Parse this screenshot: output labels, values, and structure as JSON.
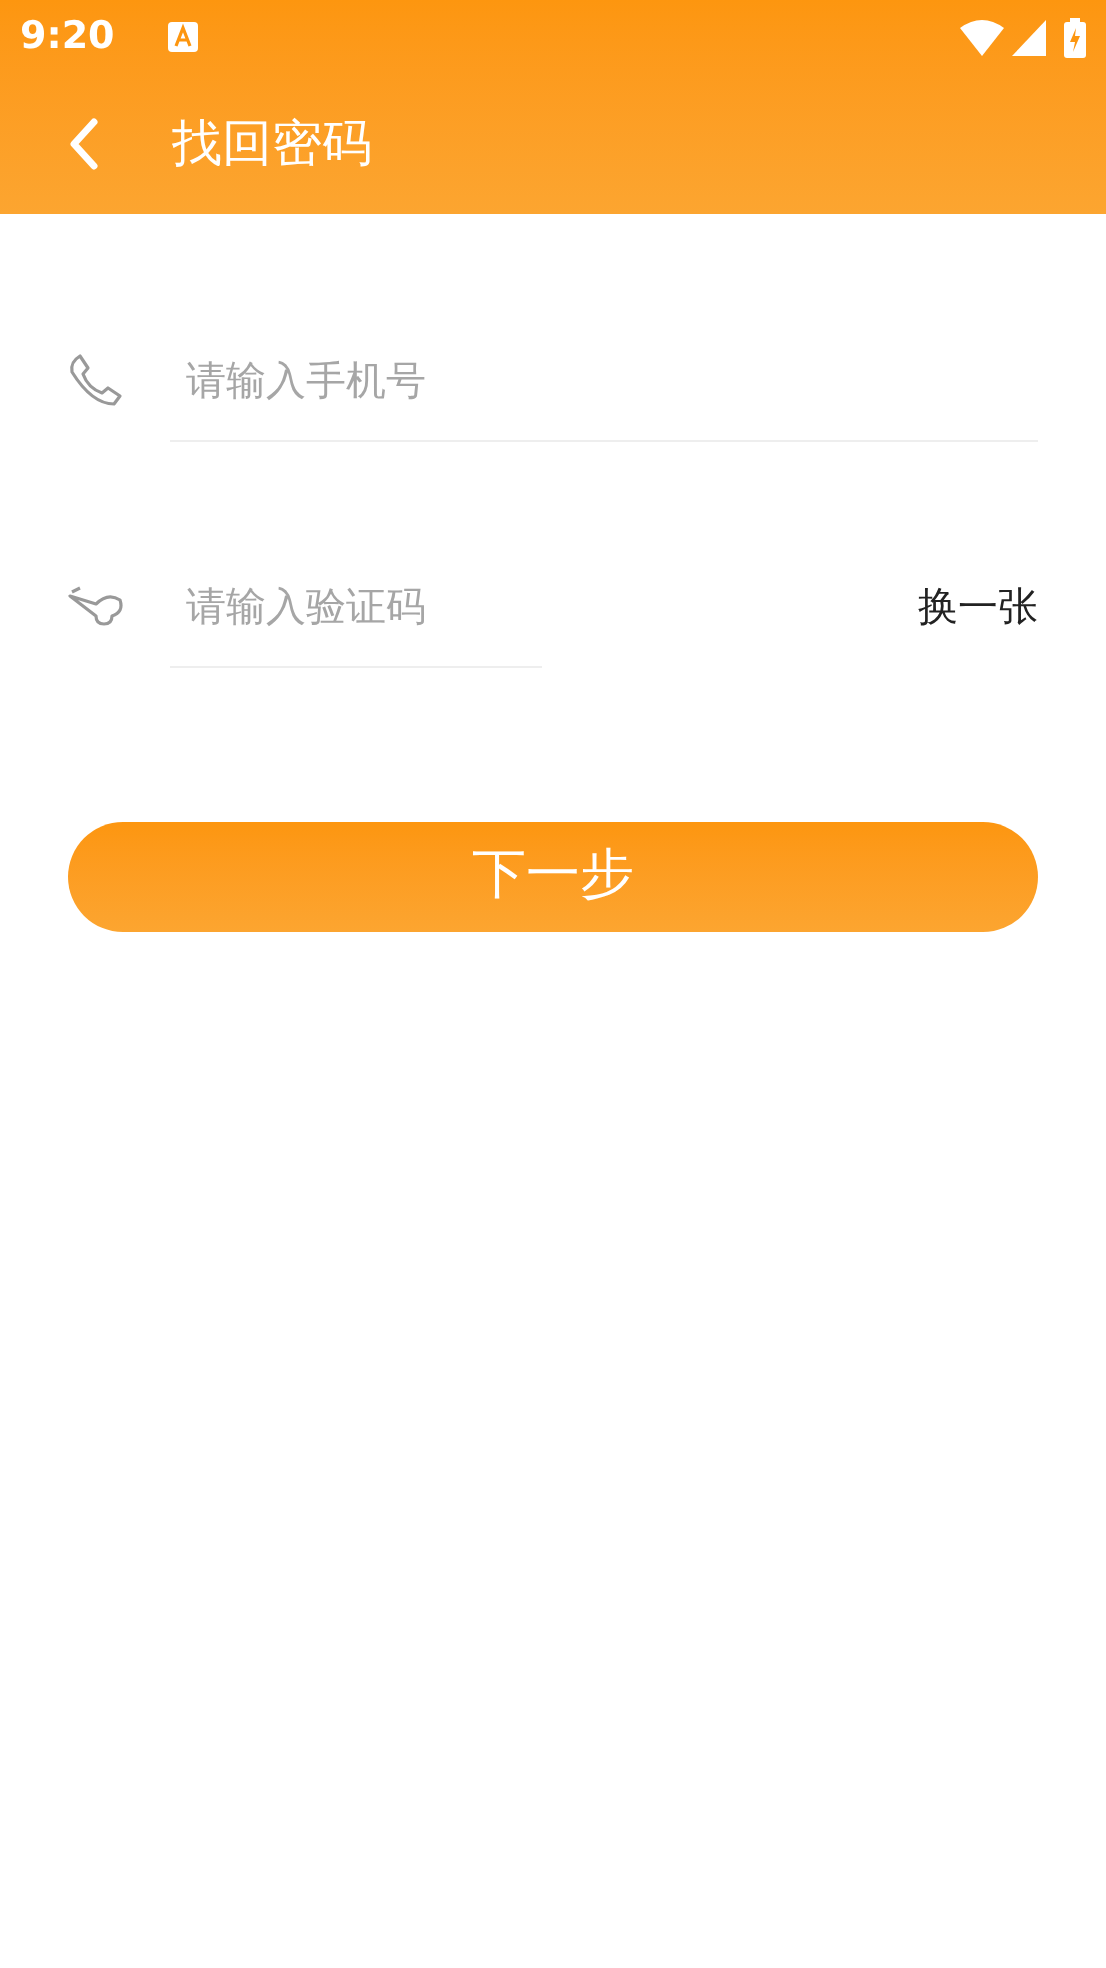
{
  "status_bar": {
    "time": "9:20"
  },
  "app_bar": {
    "title": "找回密码"
  },
  "phone_field": {
    "placeholder": "请输入手机号"
  },
  "code_field": {
    "placeholder": "请输入验证码"
  },
  "refresh_link": "换一张",
  "next_button": "下一步"
}
